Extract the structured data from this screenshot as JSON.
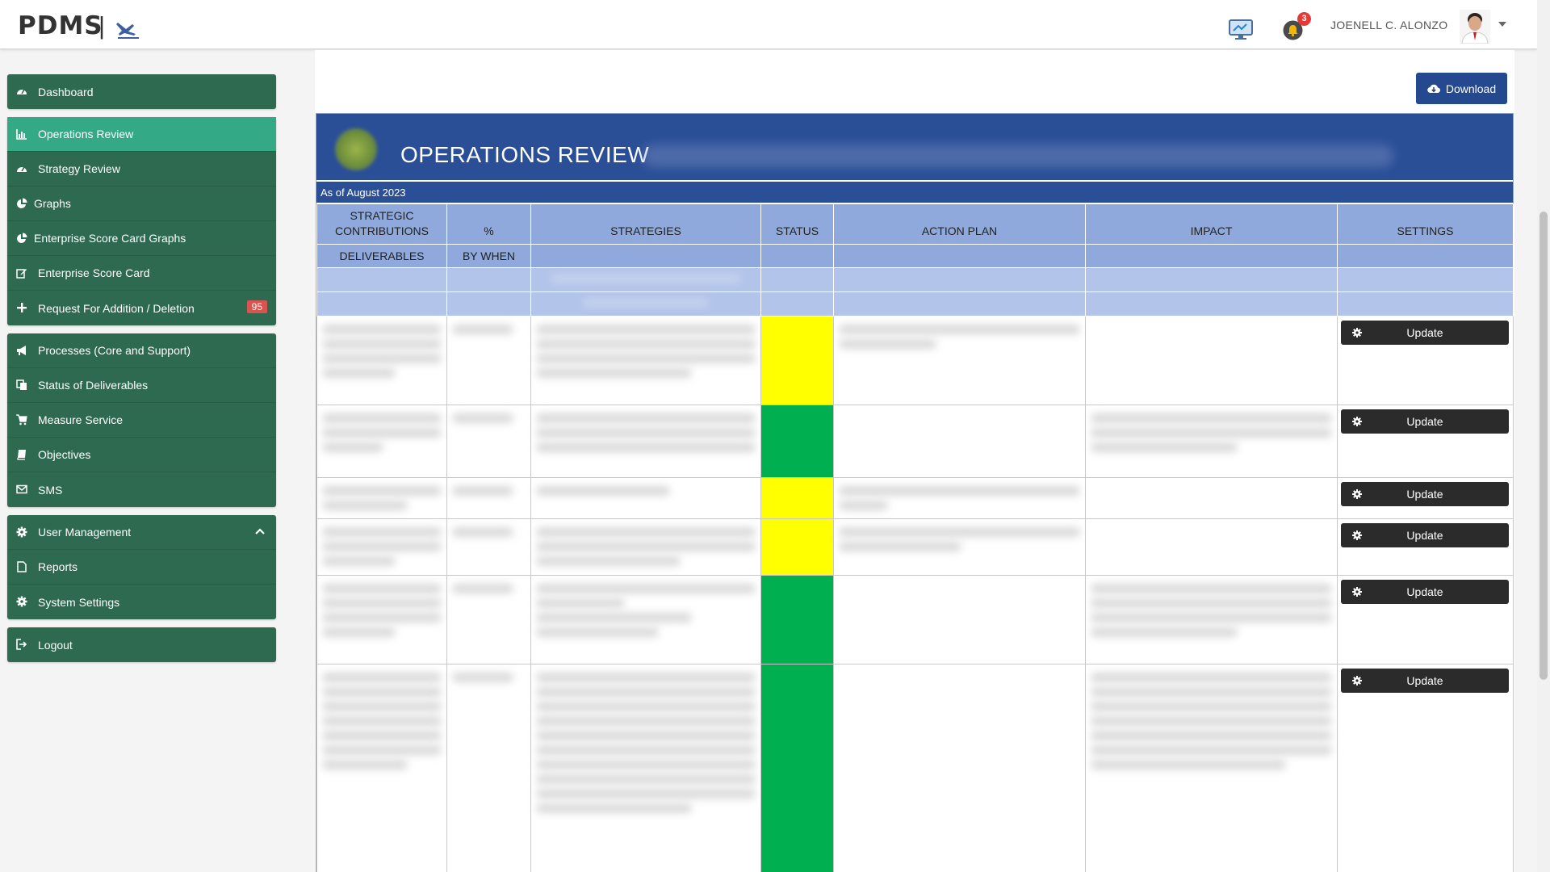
{
  "header": {
    "brand": "PDMS",
    "separator": "|",
    "notifications_count": "3",
    "username": "JOENELL C. ALONZO"
  },
  "sidebar": {
    "groups": [
      [
        {
          "label": "Dashboard",
          "icon": "dashboard-icon"
        }
      ],
      [
        {
          "label": "Operations Review",
          "icon": "bar-chart-icon",
          "active": true
        },
        {
          "label": "Strategy Review",
          "icon": "dashboard-icon"
        },
        {
          "label": "Graphs",
          "icon": "pie-chart-icon"
        },
        {
          "label": "Enterprise Score Card Graphs",
          "icon": "pie-chart-icon"
        },
        {
          "label": "Enterprise Score Card",
          "icon": "edit-icon"
        },
        {
          "label": "Request For Addition / Deletion",
          "icon": "plus-icon",
          "badge": "95"
        }
      ],
      [
        {
          "label": "Processes (Core and Support)",
          "icon": "bullhorn-icon"
        },
        {
          "label": "Status of Deliverables",
          "icon": "copy-icon"
        },
        {
          "label": "Measure Service",
          "icon": "cart-icon"
        },
        {
          "label": "Objectives",
          "icon": "book-icon"
        },
        {
          "label": "SMS",
          "icon": "envelope-icon"
        }
      ],
      [
        {
          "label": "User Management",
          "icon": "gear-icon"
        },
        {
          "label": "Reports",
          "icon": "file-icon"
        },
        {
          "label": "System Settings",
          "icon": "gear-icon"
        }
      ],
      [
        {
          "label": "Logout",
          "icon": "sign-out-icon"
        }
      ]
    ]
  },
  "main": {
    "download_label": "Download",
    "report_title": "OPERATIONS REVIEW",
    "as_of": "As of August 2023",
    "columns": {
      "strategic_contributions": "STRATEGIC CONTRIBUTIONS",
      "percent": "%",
      "strategies": "STRATEGIES",
      "status": "STATUS",
      "action_plan": "ACTION PLAN",
      "impact": "IMPACT",
      "settings": "SETTINGS",
      "deliverables": "DELIVERABLES",
      "by_when": "BY WHEN"
    },
    "update_label": "Update",
    "rows": [
      {
        "status": "yellow"
      },
      {
        "status": "green"
      },
      {
        "status": "yellow"
      },
      {
        "status": "yellow"
      },
      {
        "status": "green"
      },
      {
        "status": "green"
      }
    ]
  },
  "colors": {
    "sidebar_bg": "#2d6a4f",
    "sidebar_active": "#33a986",
    "report_header": "#2b4f97",
    "table_header": "#8fa9dd",
    "status_yellow": "#ffff00",
    "status_green": "#00b050",
    "update_button": "#2b2b2b"
  }
}
